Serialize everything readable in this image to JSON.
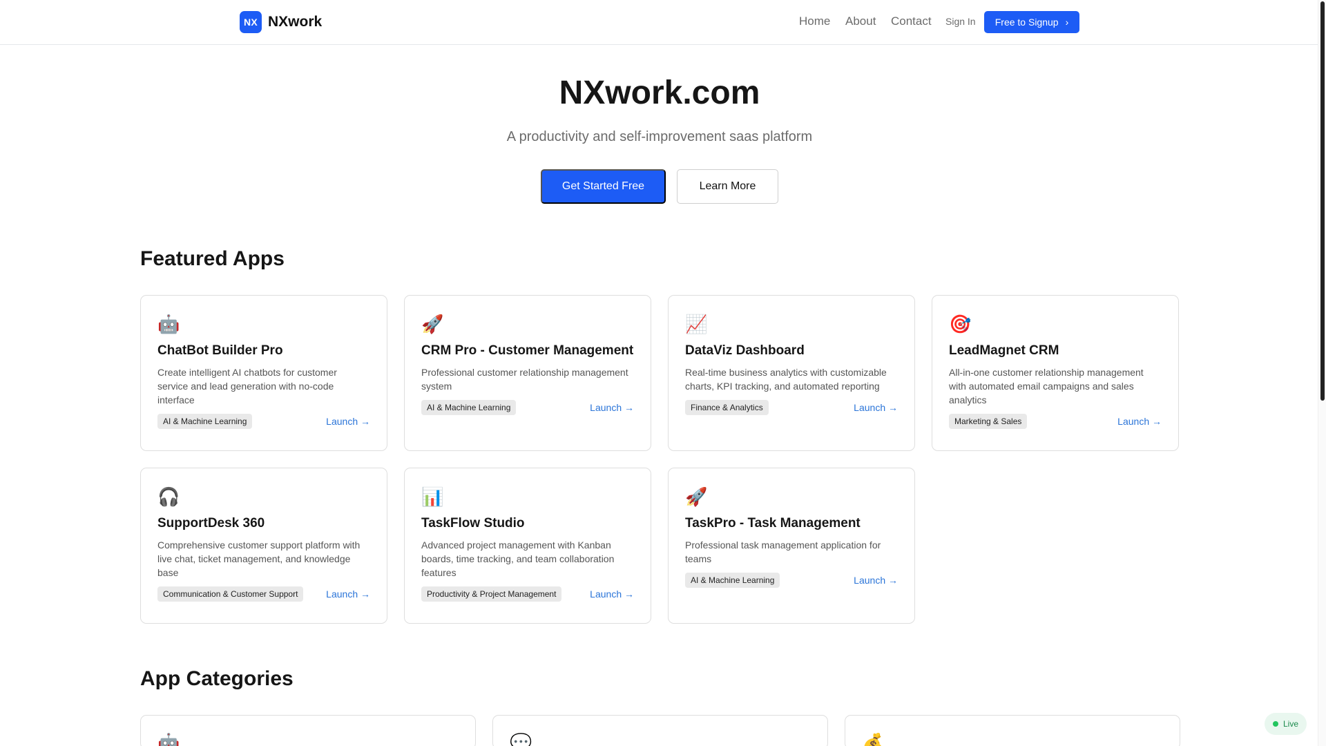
{
  "header": {
    "logo_text": "NX",
    "brand_name": "NXwork",
    "nav": [
      "Home",
      "About",
      "Contact"
    ],
    "sign_in": "Sign In",
    "signup": "Free to Signup",
    "signup_icon": "chevron-right-icon"
  },
  "hero": {
    "title": "NXwork.com",
    "subtitle": "A productivity and self-improvement saas platform",
    "primary_cta": "Get Started Free",
    "secondary_cta": "Learn More"
  },
  "featured": {
    "title": "Featured Apps",
    "apps": [
      {
        "icon": "🤖",
        "icon_name": "robot-icon",
        "title": "ChatBot Builder Pro",
        "desc": "Create intelligent AI chatbots for customer service and lead generation with no-code interface",
        "tag": "AI & Machine Learning",
        "launch": "Launch →"
      },
      {
        "icon": "🚀",
        "icon_name": "rocket-icon",
        "title": "CRM Pro - Customer Management",
        "desc": "Professional customer relationship management system",
        "tag": "AI & Machine Learning",
        "launch": "Launch →"
      },
      {
        "icon": "📈",
        "icon_name": "chart-up-icon",
        "title": "DataViz Dashboard",
        "desc": "Real-time business analytics with customizable charts, KPI tracking, and automated reporting",
        "tag": "Finance & Analytics",
        "launch": "Launch →"
      },
      {
        "icon": "🎯",
        "icon_name": "target-icon",
        "title": "LeadMagnet CRM",
        "desc": "All-in-one customer relationship management with automated email campaigns and sales analytics",
        "tag": "Marketing & Sales",
        "launch": "Launch →"
      },
      {
        "icon": "🎧",
        "icon_name": "headphones-icon",
        "title": "SupportDesk 360",
        "desc": "Comprehensive customer support platform with live chat, ticket management, and knowledge base",
        "tag": "Communication & Customer Support",
        "launch": "Launch →"
      },
      {
        "icon": "📊",
        "icon_name": "bar-chart-icon",
        "title": "TaskFlow Studio",
        "desc": "Advanced project management with Kanban boards, time tracking, and team collaboration features",
        "tag": "Productivity & Project Management",
        "launch": "Launch →"
      },
      {
        "icon": "🚀",
        "icon_name": "rocket-icon",
        "title": "TaskPro - Task Management",
        "desc": "Professional task management application for teams",
        "tag": "AI & Machine Learning",
        "launch": "Launch →"
      }
    ]
  },
  "categories": {
    "title": "App Categories",
    "items": [
      {
        "icon": "🤖",
        "icon_name": "robot-icon"
      },
      {
        "icon": "💬",
        "icon_name": "speech-bubble-icon"
      },
      {
        "icon": "💰",
        "icon_name": "money-bag-icon"
      }
    ]
  },
  "status": {
    "label": "Live",
    "color": "#22c55e"
  },
  "colors": {
    "accent": "#1d5cf5",
    "link": "#2a74d8"
  }
}
